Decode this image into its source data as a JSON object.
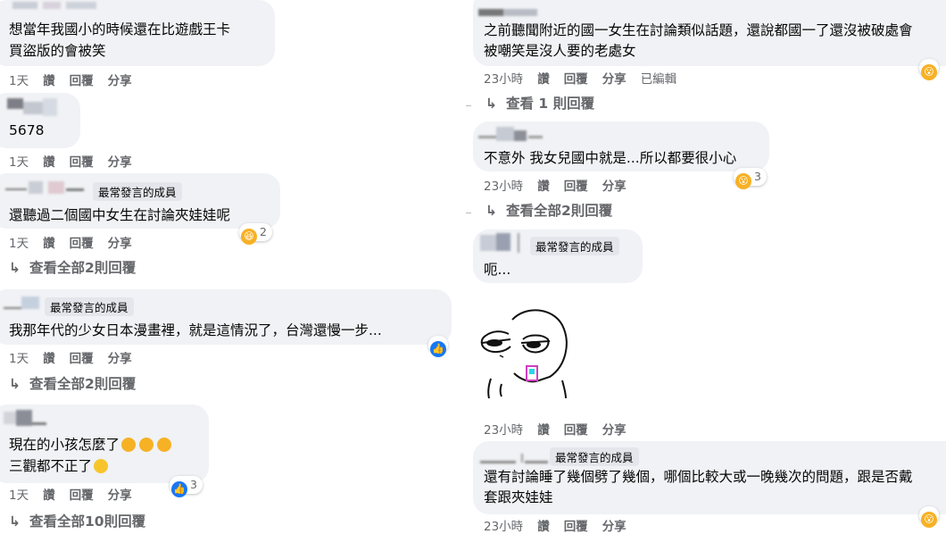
{
  "left": {
    "c1": {
      "line1": "想當年我國小的時候還在比遊戲王卡",
      "line2": "買盜版的會被笑",
      "time": "1天",
      "like": "讚",
      "reply": "回覆",
      "share": "分享"
    },
    "c2": {
      "text": "5678",
      "time": "1天",
      "like": "讚",
      "reply": "回覆",
      "share": "分享"
    },
    "c3": {
      "badge": "最常發言的成員",
      "text": "還聽過二個國中女生在討論夾娃娃呢",
      "time": "1天",
      "like": "讚",
      "reply": "回覆",
      "share": "分享",
      "reactions": "2",
      "view_replies": "查看全部2則回覆"
    },
    "c4": {
      "badge": "最常發言的成員",
      "text": "我那年代的少女日本漫畫裡，就是這情況了，台灣還慢一步...",
      "time": "1天",
      "like": "讚",
      "reply": "回覆",
      "share": "分享",
      "view_replies": "查看全部2則回覆"
    },
    "c5": {
      "line1": "現在的小孩怎麼了",
      "line2": "三觀都不正了",
      "time": "1天",
      "like": "讚",
      "reply": "回覆",
      "share": "分享",
      "reactions": "3",
      "view_replies": "查看全部10則回覆"
    }
  },
  "right": {
    "c1": {
      "line1": "之前聽聞附近的國一女生在討論類似話題，還說都國一了還沒被破處會",
      "line2": "被嘲笑是沒人要的老處女",
      "time": "23小時",
      "like": "讚",
      "reply": "回覆",
      "share": "分享",
      "edited": "已編輯",
      "view_replies": "查看 1 則回覆"
    },
    "c2": {
      "text": "不意外 我女兒國中就是...所以都要很小心",
      "time": "23小時",
      "like": "讚",
      "reply": "回覆",
      "share": "分享",
      "reactions": "3",
      "view_replies": "查看全部2則回覆"
    },
    "c3": {
      "badge": "最常發言的成員",
      "text": "呃...",
      "time": "23小時",
      "like": "讚",
      "reply": "回覆",
      "share": "分享"
    },
    "c4": {
      "badge": "最常發言的成員",
      "line1": "還有討論睡了幾個劈了幾個，哪個比較大或一晚幾次的問題，跟是否戴",
      "line2": "套跟夾娃娃",
      "time": "23小時",
      "like": "讚",
      "reply": "回覆",
      "share": "分享"
    }
  },
  "icons": {
    "arrow": "↳",
    "reply_arrow": "reply-arrow-icon"
  },
  "colors": {
    "bubble": "#f0f2f5",
    "meta": "#65676b",
    "like_blue": "#1877f2",
    "wow_yellow": "#f7b125"
  }
}
